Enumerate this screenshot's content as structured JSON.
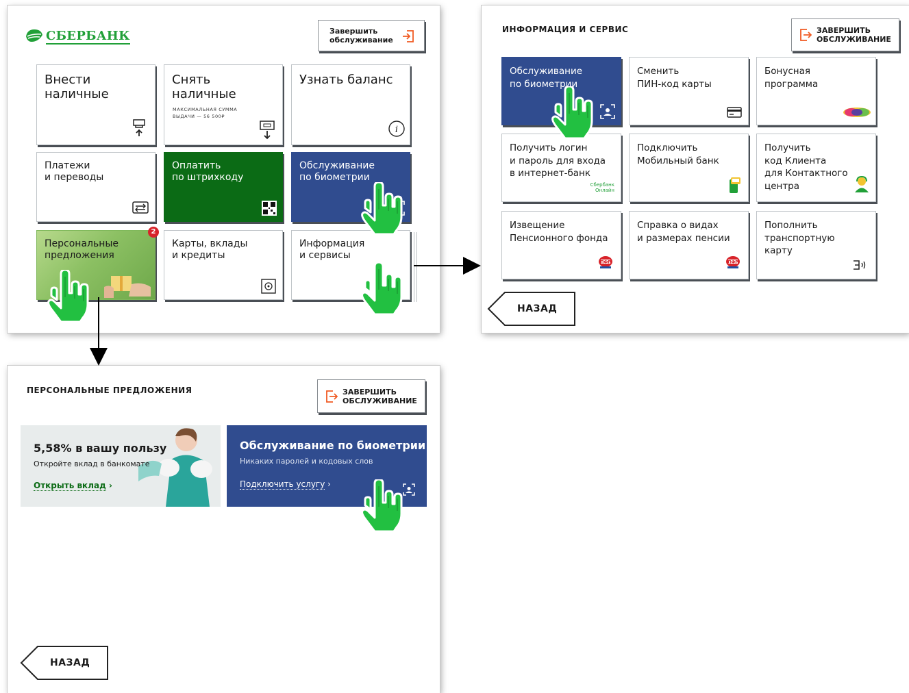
{
  "main_screen": {
    "logo": "СБЕРБАНК",
    "exit_label": "Завершить\nобслуживание",
    "tiles": [
      {
        "label": "Внести\nналичные",
        "icon": "cash-in-icon"
      },
      {
        "label": "Снять\nналичные",
        "note": "МАКСИМАЛЬНАЯ СУММА\nВЫДАЧИ — 56 500₽",
        "icon": "cash-out-icon"
      },
      {
        "label": "Узнать баланс",
        "icon": "info-icon"
      },
      {
        "label": "Платежи\nи переводы",
        "icon": "transfer-icon"
      },
      {
        "label": "Оплатить\nпо штрихкоду",
        "icon": "qr-icon"
      },
      {
        "label": "Обслуживание\nпо биометрии",
        "icon": "face-scan-icon"
      },
      {
        "label": "Персональные\nпредложения",
        "badge": "2"
      },
      {
        "label": "Карты, вклады\nи кредиты",
        "icon": "safe-icon"
      },
      {
        "label": "Информация\nи сервисы"
      }
    ]
  },
  "info_screen": {
    "title": "ИНФОРМАЦИЯ И СЕРВИС",
    "exit_label": "ЗАВЕРШИТЬ\nОБСЛУЖИВАНИЕ",
    "tiles": [
      {
        "label": "Обслуживание\nпо биометрии",
        "icon": "face-scan-icon"
      },
      {
        "label": "Сменить\nПИН-код карты",
        "icon": "card-icon"
      },
      {
        "label": "Бонусная\nпрограмма",
        "icon": "spasibo-logo-icon"
      },
      {
        "label": "Получить логин\nи пароль для входа\nв интернет-банк",
        "note": "Сбербанк\nОнлайн"
      },
      {
        "label": "Подключить\nМобильный банк",
        "icon": "phone-icon"
      },
      {
        "label": "Получить\nкод Клиента\nдля Контактного\nцентра",
        "icon": "operator-icon"
      },
      {
        "label": "Извещение\nПенсионного фонда",
        "icon": "pfr-icon"
      },
      {
        "label": "Справка о видах\nи размерах пенсии",
        "icon": "pfr-icon"
      },
      {
        "label": "Пополнить\nтранспортную\nкарту",
        "icon": "contactless-icon"
      }
    ],
    "back_label": "НАЗАД"
  },
  "personal_screen": {
    "title": "ПЕРСОНАЛЬНЫЕ ПРЕДЛОЖЕНИЯ",
    "exit_label": "ЗАВЕРШИТЬ\nОБСЛУЖИВАНИЕ",
    "banner1": {
      "title": "5,58% в вашу пользу",
      "subtitle": "Откройте вклад в банкомате",
      "link": "Открыть вклад"
    },
    "banner2": {
      "title": "Обслуживание по биометрии",
      "subtitle": "Никаких паролей и кодовых слов",
      "link": "Подключить услугу"
    },
    "back_label": "НАЗАД"
  },
  "colors": {
    "sber_green": "#21a038",
    "blue_tile": "#304c8f",
    "dark_green_tile": "#0b6b15",
    "exit_orange": "#f05a22",
    "hand_green": "#22c041"
  }
}
